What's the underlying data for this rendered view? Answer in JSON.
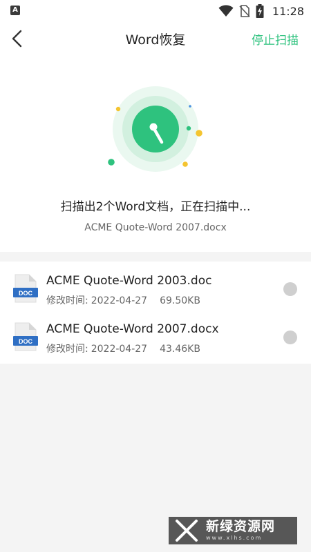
{
  "status_bar": {
    "time": "11:28",
    "app_icon_letter": "A"
  },
  "header": {
    "title": "Word恢复",
    "stop_scan_label": "停止扫描"
  },
  "scan": {
    "status_text": "扫描出2个Word文档，正在扫描中...",
    "current_file": "ACME Quote-Word 2007.docx"
  },
  "files": [
    {
      "name": "ACME Quote-Word 2003.doc",
      "modified_label": "修改时间:",
      "date": "2022-04-27",
      "size": "69.50KB",
      "icon_label": "DOC"
    },
    {
      "name": "ACME Quote-Word 2007.docx",
      "modified_label": "修改时间:",
      "date": "2022-04-27",
      "size": "43.46KB",
      "icon_label": "DOC"
    }
  ],
  "watermark": {
    "text_cn": "新绿资源网",
    "url": "www.xlhs.com"
  },
  "colors": {
    "accent_green": "#2ec27e",
    "doc_blue": "#2f6fc4",
    "radio_gray": "#cfcfcf"
  }
}
